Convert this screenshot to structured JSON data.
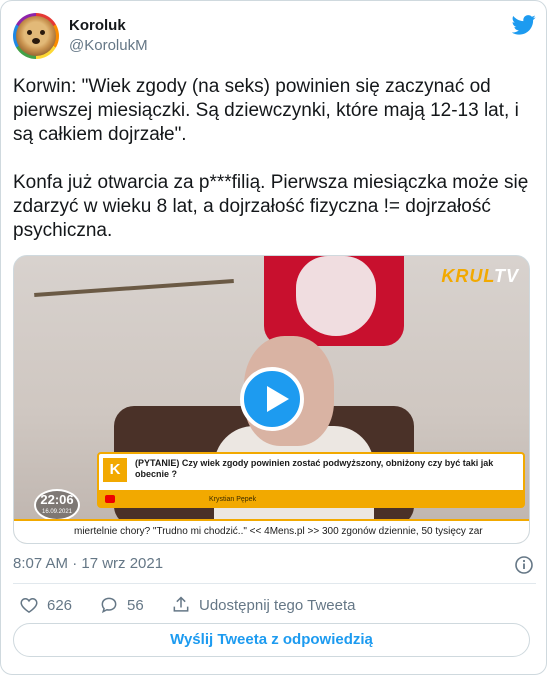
{
  "author": {
    "name": "Koroluk",
    "handle": "@KorolukM",
    "avatar_icon": "dog-avatar-rainbow-ring"
  },
  "tweet": {
    "text": "Korwin: \"Wiek zgody (na seks) powinien się zaczynać od pierwszej miesiączki. Są dziewczynki, które mają 12-13 lat, i są całkiem dojrzałe\".\n\nKonfa już otwarcia za p***filią. Pierwsza miesiączka może się zdarzyć w wieku 8 lat, a dojrzałość fizyczna != dojrzałość psychiczna.",
    "timestamp": "8:07 AM · 17 wrz 2021"
  },
  "video": {
    "logo_main": "KRUL",
    "logo_tv": "TV",
    "lower_third_letter": "K",
    "lower_third_question": "(PYTANIE) Czy wiek zgody powinien zostać podwyższony, obniżony czy być taki jak obecnie ?",
    "lower_third_author": "Krystian Pępek",
    "clock_time": "22:06",
    "clock_date": "16.09.2021",
    "ticker": "miertelnie chory? \"Trudno mi chodzić..\" << 4Mens.pl >> 300 zgonów dziennie, 50 tysięcy zar"
  },
  "actions": {
    "likes": "626",
    "replies": "56",
    "share_label": "Udostępnij tego Tweeta"
  },
  "reply_button": "Wyślij Tweeta z odpowiedzią",
  "colors": {
    "accent": "#1d9bf0",
    "secondary_text": "#657786",
    "krul_orange": "#f2a900"
  }
}
